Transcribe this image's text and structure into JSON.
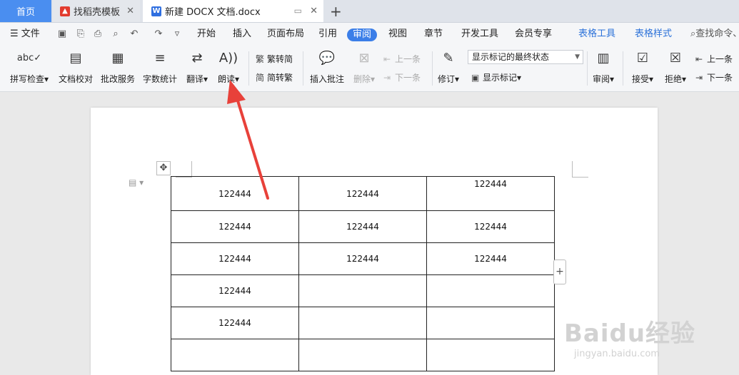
{
  "tabs": {
    "home": "首页",
    "daoke": "找稻壳模板",
    "doc": "新建 DOCX 文档.docx"
  },
  "menu": {
    "file": "文件",
    "items": [
      "开始",
      "插入",
      "页面布局",
      "引用",
      "审阅",
      "视图",
      "章节",
      "开发工具",
      "会员专享"
    ],
    "active": "审阅",
    "table_tools": "表格工具",
    "table_style": "表格样式",
    "search": "查找命令、"
  },
  "ribbon": {
    "spell": "拼写检查",
    "proof": "文档校对",
    "review_service": "批改服务",
    "word_count": "字数统计",
    "translate": "翻译",
    "read_aloud": "朗读",
    "to_simplified": "繁转简",
    "to_traditional": "简转繁",
    "insert_comment": "插入批注",
    "delete": "删除",
    "prev": "上一条",
    "next": "下一条",
    "track": "修订",
    "markup_state": "显示标记的最终状态",
    "show_markup": "显示标记",
    "review": "审阅",
    "accept": "接受",
    "reject": "拒绝",
    "prev2": "上一条",
    "next2": "下一条",
    "icons": {
      "spell": "abc-check-icon",
      "proof": "document-proof-icon",
      "service": "review-service-icon",
      "count": "word-count-icon",
      "translate": "translate-icon",
      "read": "read-aloud-icon"
    }
  },
  "table": {
    "rows": [
      [
        "122444",
        "122444",
        "122444"
      ],
      [
        "122444",
        "122444",
        "122444"
      ],
      [
        "122444",
        "122444",
        "122444"
      ],
      [
        "122444",
        "",
        ""
      ],
      [
        "122444",
        "",
        ""
      ],
      [
        "",
        "",
        ""
      ]
    ]
  },
  "watermark": {
    "brand": "Baidu经验",
    "url": "jingyan.baidu.com"
  },
  "colors": {
    "accent": "#3b7ee8",
    "arrow": "#e8413a",
    "home_tab": "#4a8ef0"
  }
}
